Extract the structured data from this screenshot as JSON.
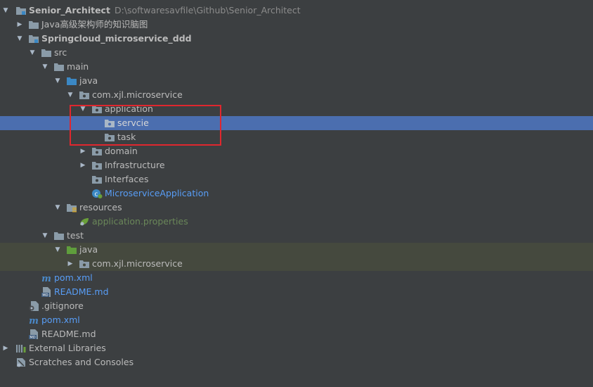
{
  "colors": {
    "background": "#3c3f41",
    "selection": "#4b6eaf",
    "test_sources_row": "#45493e",
    "highlight_box": "#e0272e",
    "folder": "#8a9ba8",
    "source_folder": "#3b88c4",
    "test_folder": "#5f9e3c"
  },
  "tree": {
    "root": {
      "name": "Senior_Architect",
      "path": "D:\\softwaresavfile\\Github\\Senior_Architect"
    },
    "java_notes": "Java高级架构师的知识脑图",
    "module": "Springcloud_microservice_ddd",
    "src": "src",
    "main": "main",
    "main_java": "java",
    "package_main": "com.xjl.microservice",
    "application": "application",
    "servcie": "servcie",
    "task": "task",
    "domain": "domain",
    "infrastructure": "Infrastructure",
    "interfaces": "Interfaces",
    "app_class": "MicroserviceApplication",
    "resources": "resources",
    "properties": "application.properties",
    "test": "test",
    "test_java": "java",
    "package_test": "com.xjl.microservice",
    "module_pom": "pom.xml",
    "module_readme": "README.md",
    "gitignore": ".gitignore",
    "root_pom": "pom.xml",
    "root_readme": "README.md",
    "external_libraries": "External Libraries",
    "scratches": "Scratches and Consoles"
  },
  "icons": {
    "expanded_arrow": "▼",
    "collapsed_arrow": "▶",
    "module": "module-icon",
    "folder": "folder-icon",
    "source_folder": "source-folder-icon",
    "test_folder": "test-folder-icon",
    "package": "package-icon",
    "resources": "resources-folder-icon",
    "spring_class": "spring-boot-class-icon",
    "properties": "spring-properties-icon",
    "maven": "maven-icon",
    "markdown": "markdown-icon",
    "gitignore": "gitignore-icon",
    "libraries": "libraries-icon",
    "scratches": "scratches-icon"
  }
}
